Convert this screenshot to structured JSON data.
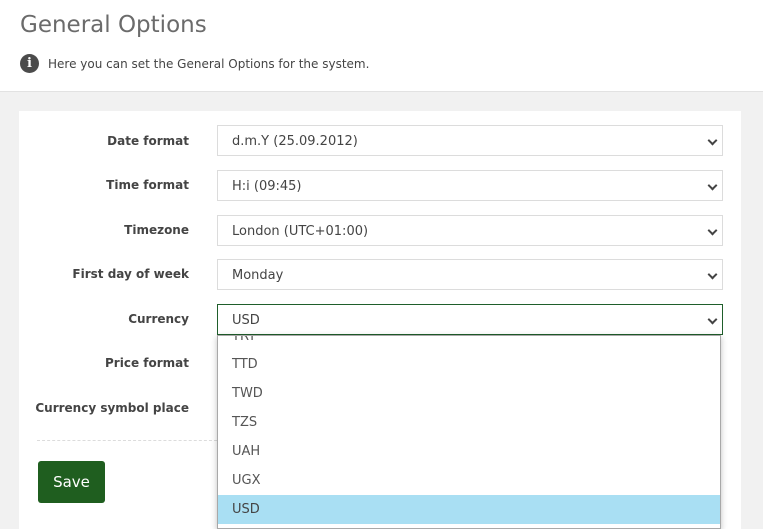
{
  "header": {
    "title": "General Options",
    "info_text": "Here you can set the General Options for the system."
  },
  "form": {
    "date_format": {
      "label": "Date format",
      "value": "d.m.Y (25.09.2012)"
    },
    "time_format": {
      "label": "Time format",
      "value": "H:i (09:45)"
    },
    "timezone": {
      "label": "Timezone",
      "value": "London (UTC+01:00)"
    },
    "first_day": {
      "label": "First day of week",
      "value": "Monday"
    },
    "currency": {
      "label": "Currency",
      "value": "USD"
    },
    "price_format": {
      "label": "Price format"
    },
    "currency_symbol_place": {
      "label": "Currency symbol place"
    }
  },
  "currency_dropdown": {
    "options": [
      "TRY",
      "TTD",
      "TWD",
      "TZS",
      "UAH",
      "UGX",
      "USD"
    ],
    "selected": "USD"
  },
  "save_label": "Save",
  "colors": {
    "accent": "#1f5e1f",
    "selected_option": "#a9dff3"
  },
  "icons": {
    "info": "info-icon",
    "chevron": "chevron-down-icon"
  }
}
